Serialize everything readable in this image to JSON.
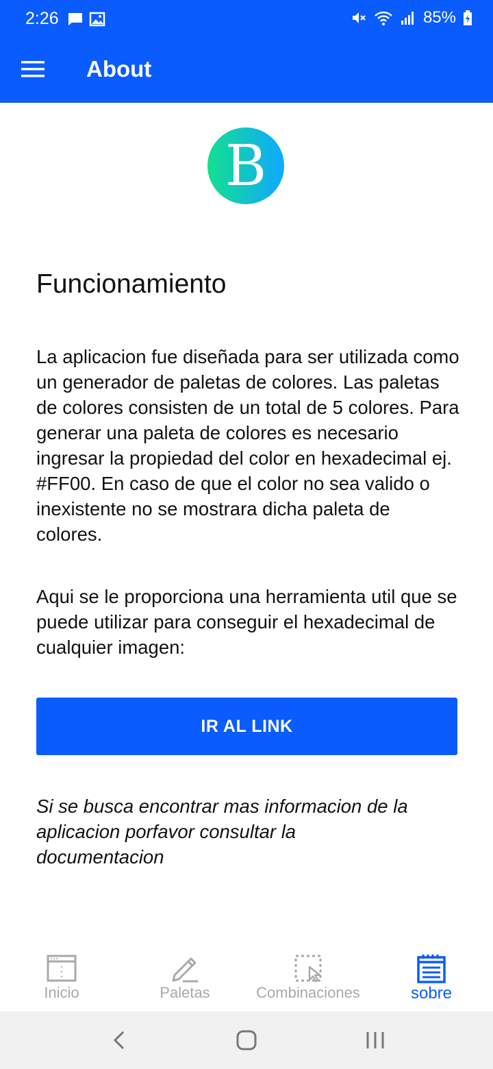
{
  "status_bar": {
    "time": "2:26",
    "battery": "85%",
    "icons": [
      "message-icon",
      "image-icon",
      "mute-icon",
      "wifi-icon",
      "signal-icon",
      "battery-icon"
    ]
  },
  "app_bar": {
    "title": "About",
    "menu_icon": "hamburger-menu-icon",
    "color": "#0a5cff"
  },
  "logo": {
    "letter": "B",
    "gradient": [
      "#13e08f",
      "#10a8ff"
    ]
  },
  "content": {
    "section_title": "Funcionamiento",
    "paragraph_1": "La aplicacion fue diseñada para ser utilizada como un generador de paletas de colores. Las paletas de colores consisten de un total de 5 colores. Para generar una paleta de colores es necesario ingresar la propiedad del color en hexadecimal ej. #FF00. En caso de que el color no sea valido o inexistente no se mostrara dicha paleta de colores.",
    "paragraph_2": "Aqui se le proporciona una herramienta util que se puede utilizar para conseguir el hexadecimal de cualquier imagen:",
    "link_button": "IR AL LINK",
    "note": "Si se busca encontrar mas informacion de la aplicacion porfavor consultar la documentacion"
  },
  "bottom_nav": {
    "items": [
      {
        "label": "Inicio",
        "icon": "window-icon",
        "active": false
      },
      {
        "label": "Paletas",
        "icon": "pencil-icon",
        "active": false
      },
      {
        "label": "Combinaciones",
        "icon": "selection-cursor-icon",
        "active": false
      },
      {
        "label": "sobre",
        "icon": "notepad-icon",
        "active": true
      }
    ],
    "active_color": "#0a5cff",
    "inactive_color": "#a9a9a9"
  },
  "system_nav": {
    "buttons": [
      "back-icon",
      "home-icon",
      "recents-icon"
    ]
  }
}
